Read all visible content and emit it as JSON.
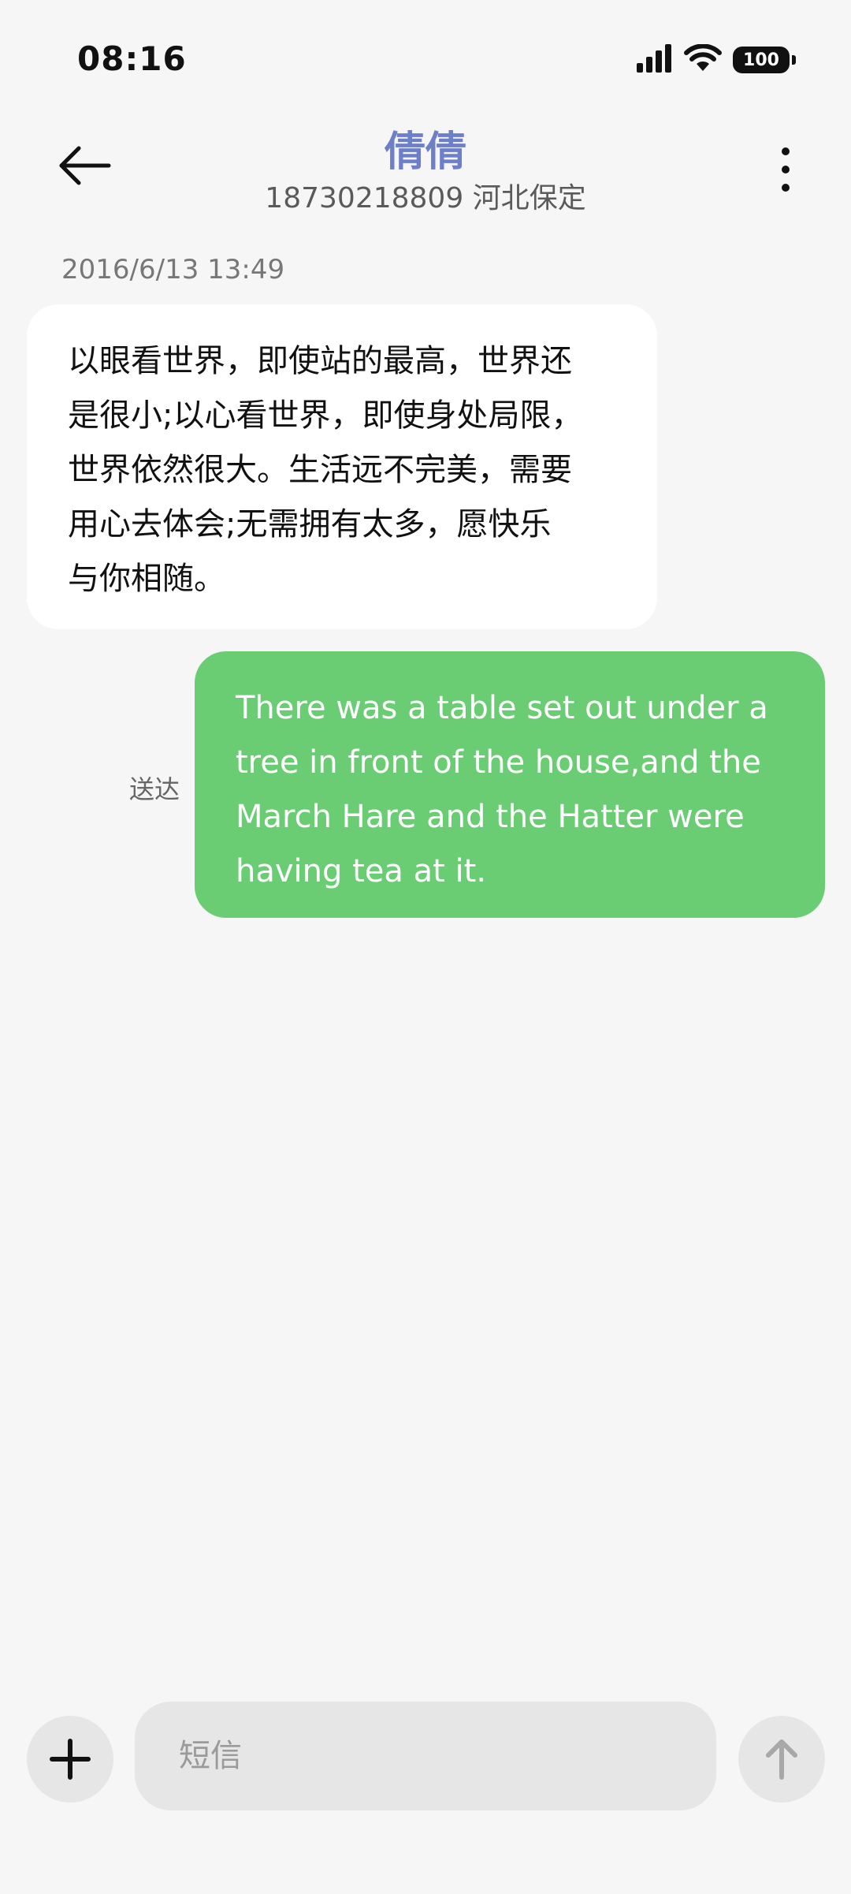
{
  "status_bar": {
    "time": "08:16",
    "battery": "100",
    "icons": [
      "signal-icon",
      "wifi-icon",
      "battery-icon"
    ]
  },
  "header": {
    "contact_name": "倩倩",
    "contact_info": "18730218809 河北保定",
    "name_color": "#6e7fc9",
    "icons": [
      "back-arrow-icon",
      "more-vertical-icon"
    ]
  },
  "conversation": {
    "timestamp": "2016/6/13 13:49",
    "messages": [
      {
        "direction": "incoming",
        "lines": [
          "以眼看世界，即使站的最高，世界还",
          "是很小;以心看世界，即使身处局限，",
          "世界依然很大。生活远不完美，需要",
          "用心去体会;无需拥有太多，愿快乐",
          "与你相随。"
        ]
      },
      {
        "direction": "outgoing",
        "lines": [
          "There was a table set out under a",
          "tree in front of the house,and the",
          "March Hare and the Hatter were",
          "having tea at it."
        ],
        "status": "送达",
        "bubble_color": "#6bcd73"
      }
    ]
  },
  "composer": {
    "placeholder": "短信",
    "icons": [
      "plus-icon",
      "send-arrow-icon"
    ]
  }
}
